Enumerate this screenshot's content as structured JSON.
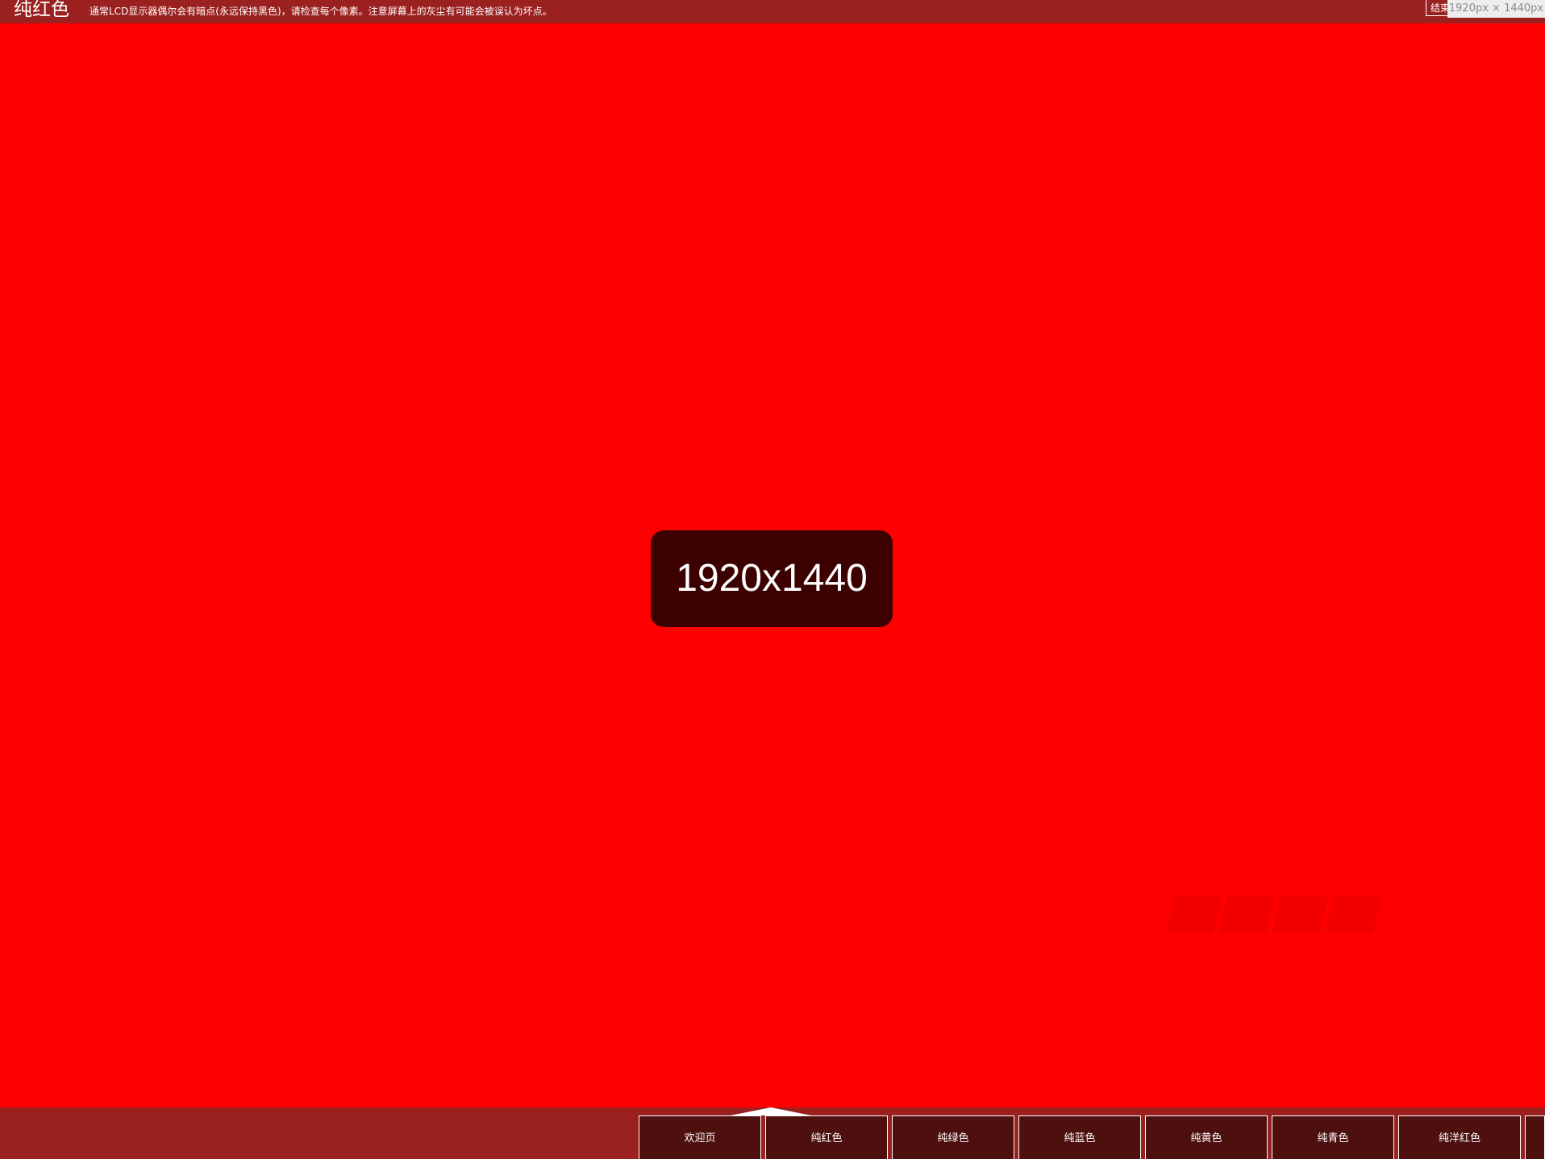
{
  "header": {
    "title": "纯红色",
    "notice": "通常LCD显示器偶尔会有暗点(永远保持黑色)，请检查每个像素。注意屏幕上的灰尘有可能会被误认为坏点。",
    "end_button_label": "结束",
    "screen_size_readout": "1920px × 1440px"
  },
  "display": {
    "resolution_label": "1920x1440",
    "test_color": "#ff0000",
    "bar_color": "#9b2020",
    "badge_color": "#3d0000"
  },
  "nav": {
    "tabs": [
      {
        "label": "欢迎页"
      },
      {
        "label": "纯红色"
      },
      {
        "label": "纯绿色"
      },
      {
        "label": "纯蓝色"
      },
      {
        "label": "纯黄色"
      },
      {
        "label": "纯青色"
      },
      {
        "label": "纯洋红色"
      },
      {
        "label": ""
      }
    ],
    "active_tab_index": 1
  }
}
